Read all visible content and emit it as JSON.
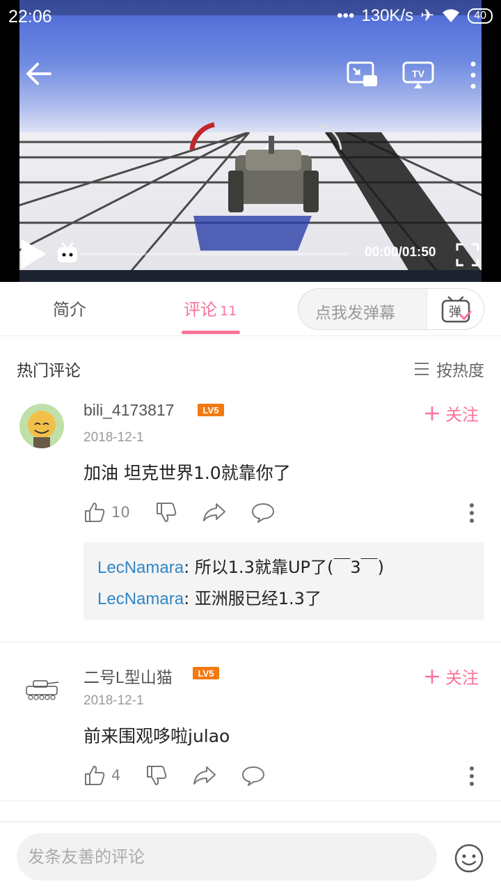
{
  "status_bar": {
    "time": "22:06",
    "net_speed": "130K/s",
    "battery": "40"
  },
  "video": {
    "time_display": "00:00/01:50",
    "progress_fraction": 0.0,
    "icons": [
      "back-icon",
      "cast-icon",
      "tv-icon",
      "more-icon",
      "play-icon",
      "bili-icon",
      "fullscreen-icon"
    ]
  },
  "tabs": {
    "intro_label": "简介",
    "comments_label": "评论",
    "comments_count": "11",
    "danmaku_placeholder": "点我发弹幕",
    "danmaku_button": "弹"
  },
  "comments_section": {
    "title": "热门评论",
    "sort_label": "按热度"
  },
  "comments": [
    {
      "username": "bili_4173817",
      "level": "LV5",
      "date": "2018-12-1",
      "follow_label": "关注",
      "text": "加油 坦克世界1.0就靠你了",
      "likes": "10",
      "replies": [
        {
          "name": "LecNamara",
          "text": ": 所以1.3就靠UP了(￣3￣)"
        },
        {
          "name": "LecNamara",
          "text": ": 亚洲服已经1.3了"
        }
      ]
    },
    {
      "username": "二号L型山猫",
      "level": "LV5",
      "date": "2018-12-1",
      "follow_label": "关注",
      "text": "前来围观哆啦julao",
      "likes": "4",
      "replies": []
    }
  ],
  "bottom_input": {
    "placeholder": "发条友善的评论"
  },
  "colors": {
    "accent": "#fb7299",
    "reply_name": "#2f86c9",
    "level_badge": "#f37a10"
  }
}
